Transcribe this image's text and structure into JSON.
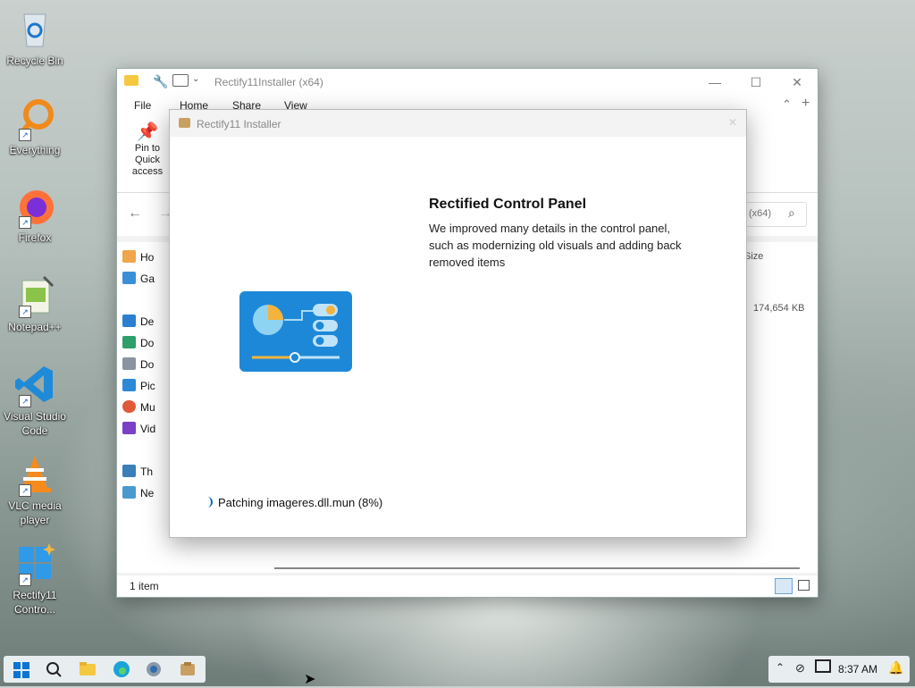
{
  "desktop": {
    "icons": [
      {
        "label": "Recycle Bin"
      },
      {
        "label": "Everything"
      },
      {
        "label": "Firefox"
      },
      {
        "label": "Notepad++"
      },
      {
        "label": "Visual Studio Code"
      },
      {
        "label": "VLC media player"
      },
      {
        "label": "Rectify11 Contro..."
      }
    ]
  },
  "explorer": {
    "title": "Rectify11Installer (x64)",
    "tabs": [
      "File",
      "Home",
      "Share",
      "View"
    ],
    "ribbon_pin_label": "Pin to Quick access",
    "search_text": "(x64)",
    "column_size": "Size",
    "file_size": "174,654 KB",
    "nav": [
      "Ho",
      "Ga",
      "De",
      "Do",
      "Do",
      "Pic",
      "Mu",
      "Vid",
      "Th",
      "Ne"
    ],
    "status": "1 item"
  },
  "installer": {
    "title": "Rectify11 Installer",
    "headline": "Rectified Control Panel",
    "description": "We improved many details in the control panel, such as modernizing old visuals and adding back removed items",
    "progress_text": "Patching imageres.dll.mun (8%)",
    "progress_percent": 8
  },
  "taskbar": {
    "time": "8:37 AM"
  },
  "colors": {
    "accent": "#0067c0",
    "panel_icon": "#1e88d8"
  }
}
